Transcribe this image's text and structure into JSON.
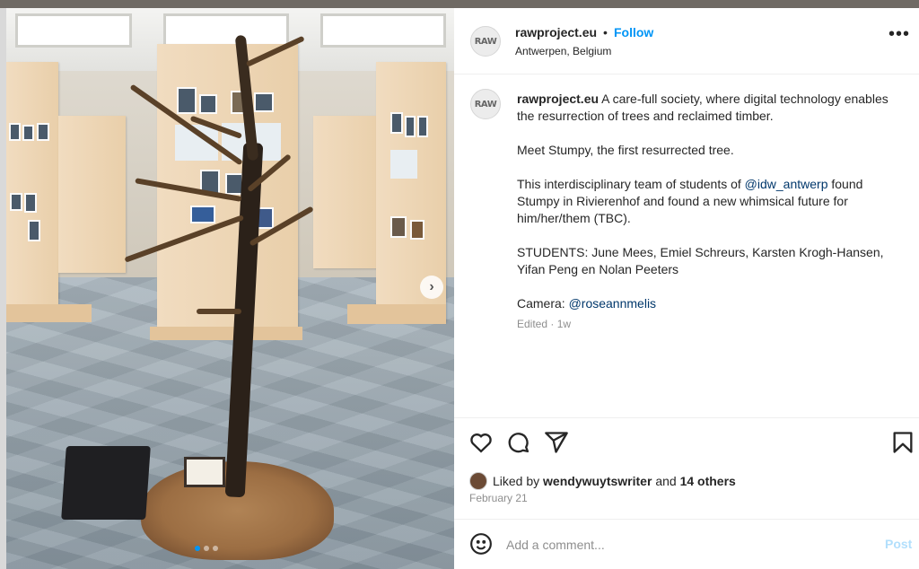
{
  "post": {
    "username": "rawproject.eu",
    "separator": "•",
    "follow_label": "Follow",
    "location": "Antwerpen, Belgium",
    "avatar_text": "RAW",
    "more_icon": "more-horizontal-icon"
  },
  "caption": {
    "username": "rawproject.eu",
    "para1_text": "A care-full society, where digital technology enables the resurrection of trees and reclaimed timber.",
    "para2": "Meet Stumpy, the first resurrected tree.",
    "para3_before": "This interdisciplinary team of students of ",
    "para3_mention": "@idw_antwerp",
    "para3_after": " found Stumpy in Rivierenhof and found a new whimsical future for him/her/them (TBC).",
    "para4": "STUDENTS: June Mees, Emiel Schreurs, Karsten Krogh-Hansen, Yifan Peng en Nolan Peeters",
    "para5_prefix": "Camera: ",
    "para5_mention": "@roseannmelis",
    "edited": "Edited · 1w"
  },
  "actions": {
    "icons": [
      "heart-icon",
      "comment-icon",
      "share-icon",
      "bookmark-icon"
    ],
    "liked_prefix": "Liked by ",
    "liked_user": "wendywuytswriter",
    "liked_mid": " and ",
    "liked_others": "14 others",
    "date": "February 21"
  },
  "comment": {
    "placeholder": "Add a comment...",
    "post_label": "Post",
    "emoji_icon": "emoji-icon"
  },
  "photo": {
    "next_arrow": "›",
    "carousel_total": 3,
    "carousel_active": 1
  },
  "colors": {
    "accent": "#0095f6",
    "mention": "#00376b",
    "muted": "#8e8e8e",
    "post_disabled": "#b2dffc"
  }
}
